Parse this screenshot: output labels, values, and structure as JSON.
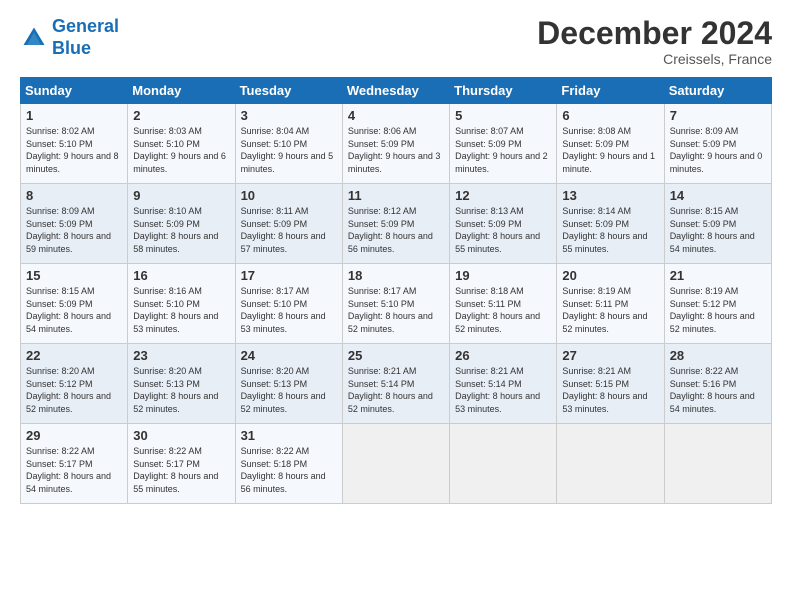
{
  "header": {
    "logo_line1": "General",
    "logo_line2": "Blue",
    "month": "December 2024",
    "location": "Creissels, France"
  },
  "days_of_week": [
    "Sunday",
    "Monday",
    "Tuesday",
    "Wednesday",
    "Thursday",
    "Friday",
    "Saturday"
  ],
  "weeks": [
    [
      {
        "day": 1,
        "rise": "8:02 AM",
        "set": "5:10 PM",
        "hours": "9 hours and 8 minutes."
      },
      {
        "day": 2,
        "rise": "8:03 AM",
        "set": "5:10 PM",
        "hours": "9 hours and 6 minutes."
      },
      {
        "day": 3,
        "rise": "8:04 AM",
        "set": "5:10 PM",
        "hours": "9 hours and 5 minutes."
      },
      {
        "day": 4,
        "rise": "8:06 AM",
        "set": "5:09 PM",
        "hours": "9 hours and 3 minutes."
      },
      {
        "day": 5,
        "rise": "8:07 AM",
        "set": "5:09 PM",
        "hours": "9 hours and 2 minutes."
      },
      {
        "day": 6,
        "rise": "8:08 AM",
        "set": "5:09 PM",
        "hours": "9 hours and 1 minute."
      },
      {
        "day": 7,
        "rise": "8:09 AM",
        "set": "5:09 PM",
        "hours": "9 hours and 0 minutes."
      }
    ],
    [
      {
        "day": 8,
        "rise": "8:09 AM",
        "set": "5:09 PM",
        "hours": "8 hours and 59 minutes."
      },
      {
        "day": 9,
        "rise": "8:10 AM",
        "set": "5:09 PM",
        "hours": "8 hours and 58 minutes."
      },
      {
        "day": 10,
        "rise": "8:11 AM",
        "set": "5:09 PM",
        "hours": "8 hours and 57 minutes."
      },
      {
        "day": 11,
        "rise": "8:12 AM",
        "set": "5:09 PM",
        "hours": "8 hours and 56 minutes."
      },
      {
        "day": 12,
        "rise": "8:13 AM",
        "set": "5:09 PM",
        "hours": "8 hours and 55 minutes."
      },
      {
        "day": 13,
        "rise": "8:14 AM",
        "set": "5:09 PM",
        "hours": "8 hours and 55 minutes."
      },
      {
        "day": 14,
        "rise": "8:15 AM",
        "set": "5:09 PM",
        "hours": "8 hours and 54 minutes."
      }
    ],
    [
      {
        "day": 15,
        "rise": "8:15 AM",
        "set": "5:09 PM",
        "hours": "8 hours and 54 minutes."
      },
      {
        "day": 16,
        "rise": "8:16 AM",
        "set": "5:10 PM",
        "hours": "8 hours and 53 minutes."
      },
      {
        "day": 17,
        "rise": "8:17 AM",
        "set": "5:10 PM",
        "hours": "8 hours and 53 minutes."
      },
      {
        "day": 18,
        "rise": "8:17 AM",
        "set": "5:10 PM",
        "hours": "8 hours and 52 minutes."
      },
      {
        "day": 19,
        "rise": "8:18 AM",
        "set": "5:11 PM",
        "hours": "8 hours and 52 minutes."
      },
      {
        "day": 20,
        "rise": "8:19 AM",
        "set": "5:11 PM",
        "hours": "8 hours and 52 minutes."
      },
      {
        "day": 21,
        "rise": "8:19 AM",
        "set": "5:12 PM",
        "hours": "8 hours and 52 minutes."
      }
    ],
    [
      {
        "day": 22,
        "rise": "8:20 AM",
        "set": "5:12 PM",
        "hours": "8 hours and 52 minutes."
      },
      {
        "day": 23,
        "rise": "8:20 AM",
        "set": "5:13 PM",
        "hours": "8 hours and 52 minutes."
      },
      {
        "day": 24,
        "rise": "8:20 AM",
        "set": "5:13 PM",
        "hours": "8 hours and 52 minutes."
      },
      {
        "day": 25,
        "rise": "8:21 AM",
        "set": "5:14 PM",
        "hours": "8 hours and 52 minutes."
      },
      {
        "day": 26,
        "rise": "8:21 AM",
        "set": "5:14 PM",
        "hours": "8 hours and 53 minutes."
      },
      {
        "day": 27,
        "rise": "8:21 AM",
        "set": "5:15 PM",
        "hours": "8 hours and 53 minutes."
      },
      {
        "day": 28,
        "rise": "8:22 AM",
        "set": "5:16 PM",
        "hours": "8 hours and 54 minutes."
      }
    ],
    [
      {
        "day": 29,
        "rise": "8:22 AM",
        "set": "5:17 PM",
        "hours": "8 hours and 54 minutes."
      },
      {
        "day": 30,
        "rise": "8:22 AM",
        "set": "5:17 PM",
        "hours": "8 hours and 55 minutes."
      },
      {
        "day": 31,
        "rise": "8:22 AM",
        "set": "5:18 PM",
        "hours": "8 hours and 56 minutes."
      },
      null,
      null,
      null,
      null
    ]
  ]
}
